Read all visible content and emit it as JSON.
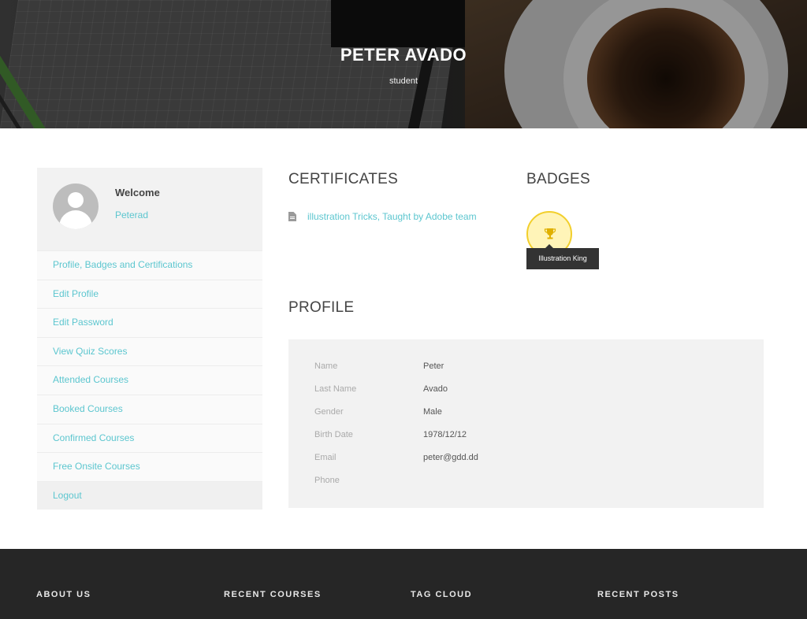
{
  "hero": {
    "title": "PETER AVADO",
    "subtitle": "student"
  },
  "sidebar": {
    "welcome": "Welcome",
    "username": "Peterad",
    "items": [
      {
        "label": "Profile, Badges and Certifications"
      },
      {
        "label": "Edit Profile"
      },
      {
        "label": "Edit Password"
      },
      {
        "label": "View Quiz Scores"
      },
      {
        "label": "Attended Courses"
      },
      {
        "label": "Booked Courses"
      },
      {
        "label": "Confirmed Courses"
      },
      {
        "label": "Free Onsite Courses"
      },
      {
        "label": "Logout"
      }
    ]
  },
  "certificates": {
    "title": "CERTIFICATES",
    "items": [
      {
        "label": "illustration Tricks, Taught by Adobe team",
        "icon": "document-icon"
      }
    ]
  },
  "badges": {
    "title": "BADGES",
    "items": [
      {
        "name": "Illustration King",
        "icon": "trophy-icon",
        "color": "#f2cf2c"
      }
    ]
  },
  "profile": {
    "title": "PROFILE",
    "fields": [
      {
        "label": "Name",
        "value": "Peter"
      },
      {
        "label": "Last Name",
        "value": "Avado"
      },
      {
        "label": "Gender",
        "value": "Male"
      },
      {
        "label": "Birth Date",
        "value": "1978/12/12"
      },
      {
        "label": "Email",
        "value": "peter@gdd.dd"
      },
      {
        "label": "Phone",
        "value": ""
      }
    ]
  },
  "footer": {
    "columns": [
      "ABOUT US",
      "RECENT COURSES",
      "TAG CLOUD",
      "RECENT POSTS"
    ]
  },
  "colors": {
    "accent": "#5cc6cf",
    "badge": "#f2cf2c",
    "footer": "#262626"
  }
}
